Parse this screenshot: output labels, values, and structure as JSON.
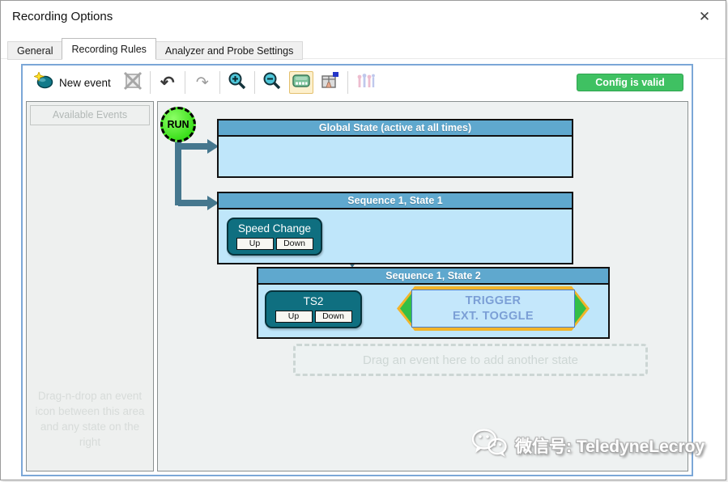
{
  "window": {
    "title": "Recording Options",
    "close_glyph": "✕"
  },
  "tabs": [
    {
      "label": "General"
    },
    {
      "label": "Recording Rules"
    },
    {
      "label": "Analyzer and Probe Settings"
    }
  ],
  "toolbar": {
    "new_event_label": "New event",
    "undo_glyph": "↶",
    "redo_glyph": "↷",
    "status_label": "Config is valid"
  },
  "left_panel": {
    "header": "Available Events",
    "hint": "Drag-n-drop an event icon between this area and any state on the right"
  },
  "diagram": {
    "run_label": "RUN",
    "global_state": {
      "title": "Global State (active at all times)"
    },
    "state1": {
      "title": "Sequence 1, State 1",
      "event": {
        "name": "Speed Change",
        "button_up": "Up",
        "button_down": "Down"
      }
    },
    "state2": {
      "title": "Sequence 1, State 2",
      "event": {
        "name": "TS2",
        "button_up": "Up",
        "button_down": "Down"
      },
      "action_line1": "TRIGGER",
      "action_line2": "EXT. TOGGLE"
    },
    "drop_hint": "Drag an event here to add another state"
  },
  "watermark": {
    "text": "微信号: TeledyneLecroy"
  },
  "colors": {
    "state_header": "#5fa8ce",
    "state_body": "#bfe6fa",
    "event_box": "#0f6f80",
    "arrow": "#45778e",
    "run_green": "#1ed300",
    "trigger_border": "#f2b42a",
    "trigger_chevron": "#33bf46",
    "trigger_text": "#7b9fd6",
    "status_green": "#3fc162",
    "toolbar_border": "#7ba7d7"
  },
  "icons": [
    "new-event-icon",
    "delete-event-icon",
    "undo-icon",
    "redo-icon",
    "zoom-in-icon",
    "zoom-out-icon",
    "recorder-icon",
    "properties-icon",
    "analyzer-icon",
    "close-icon",
    "wechat-icon"
  ]
}
